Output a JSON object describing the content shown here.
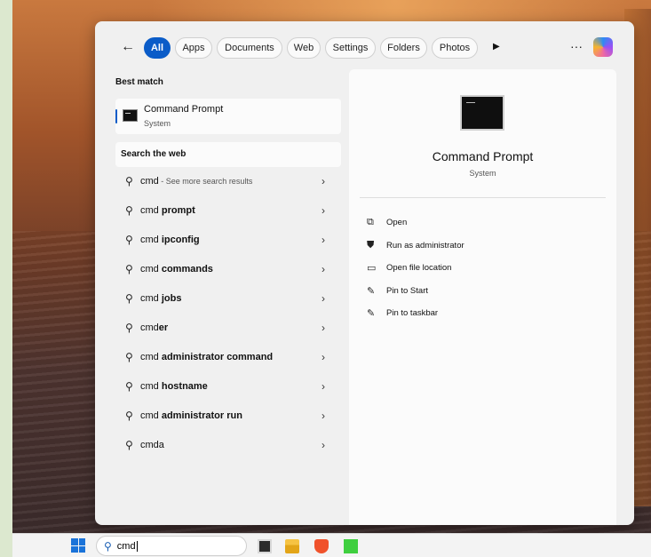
{
  "filters": {
    "back_icon": "arrow-left-icon",
    "chips": [
      {
        "label": "All",
        "active": true
      },
      {
        "label": "Apps",
        "active": false
      },
      {
        "label": "Documents",
        "active": false
      },
      {
        "label": "Web",
        "active": false
      },
      {
        "label": "Settings",
        "active": false
      },
      {
        "label": "Folders",
        "active": false
      },
      {
        "label": "Photos",
        "active": false
      }
    ],
    "more_icon": "play-icon",
    "overflow_label": "···"
  },
  "best_match": {
    "heading": "Best match",
    "title": "Command Prompt",
    "subtitle": "System"
  },
  "web": {
    "heading": "Search the web",
    "items": [
      {
        "prefix": "cmd",
        "bold": "",
        "suffix": " - See more search results"
      },
      {
        "prefix": "cmd ",
        "bold": "prompt",
        "suffix": ""
      },
      {
        "prefix": "cmd ",
        "bold": "ipconfig",
        "suffix": ""
      },
      {
        "prefix": "cmd ",
        "bold": "commands",
        "suffix": ""
      },
      {
        "prefix": "cmd ",
        "bold": "jobs",
        "suffix": ""
      },
      {
        "prefix": "cmd",
        "bold": "er",
        "suffix": ""
      },
      {
        "prefix": "cmd ",
        "bold": "administrator command",
        "suffix": ""
      },
      {
        "prefix": "cmd ",
        "bold": "hostname",
        "suffix": ""
      },
      {
        "prefix": "cmd ",
        "bold": "administrator run",
        "suffix": ""
      },
      {
        "prefix": "cmda",
        "bold": "",
        "suffix": ""
      }
    ]
  },
  "detail": {
    "title": "Command Prompt",
    "subtitle": "System",
    "actions": [
      {
        "icon": "open-external-icon",
        "glyph": "⧉",
        "label": "Open"
      },
      {
        "icon": "shield-admin-icon",
        "glyph": "⛊",
        "label": "Run as administrator"
      },
      {
        "icon": "folder-icon",
        "glyph": "▭",
        "label": "Open file location"
      },
      {
        "icon": "pin-icon",
        "glyph": "✎",
        "label": "Pin to Start"
      },
      {
        "icon": "pin-icon",
        "glyph": "✎",
        "label": "Pin to taskbar"
      }
    ]
  },
  "taskbar": {
    "search_value": "cmd"
  },
  "colors": {
    "accent": "#0b5cc8"
  }
}
